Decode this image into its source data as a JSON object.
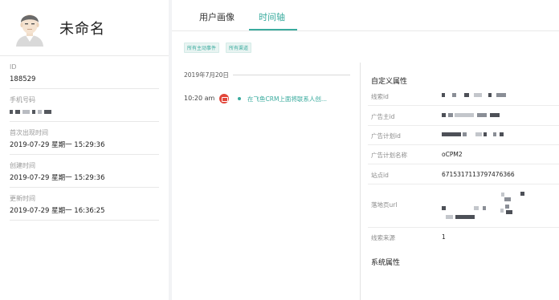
{
  "profile": {
    "name": "未命名",
    "fields": [
      {
        "label": "ID",
        "value": "188529"
      },
      {
        "label": "手机号码",
        "value": ""
      },
      {
        "label": "首次出现时间",
        "value": "2019-07-29 星期一 15:29:36"
      },
      {
        "label": "创建时间",
        "value": "2019-07-29 星期一 15:29:36"
      },
      {
        "label": "更新时间",
        "value": "2019-07-29 星期一 16:36:25"
      }
    ]
  },
  "tabs": [
    {
      "label": "用户画像",
      "active": false
    },
    {
      "label": "时间轴",
      "active": true
    }
  ],
  "filters": [
    "所有主动事件",
    "所有渠道"
  ],
  "timeline": {
    "date": "2019年7月20日",
    "events": [
      {
        "time": "10:20 am",
        "icon": "crm-event-icon",
        "text": "在飞鱼CRM上面将联系人创..."
      }
    ]
  },
  "details": {
    "custom_title": "自定义属性",
    "custom_attrs": [
      {
        "label": "线索id",
        "value": ""
      },
      {
        "label": "广告主id",
        "value": ""
      },
      {
        "label": "广告计划id",
        "value": ""
      },
      {
        "label": "广告计划名称",
        "value": "oCPM2"
      },
      {
        "label": "站点id",
        "value": "6715317113797476366"
      },
      {
        "label": "落地页url",
        "value": ""
      },
      {
        "label": "线索来源",
        "value": "1"
      }
    ],
    "system_title": "系统属性"
  },
  "colors": {
    "accent": "#3aab9e",
    "event_icon": "#e2463a"
  }
}
